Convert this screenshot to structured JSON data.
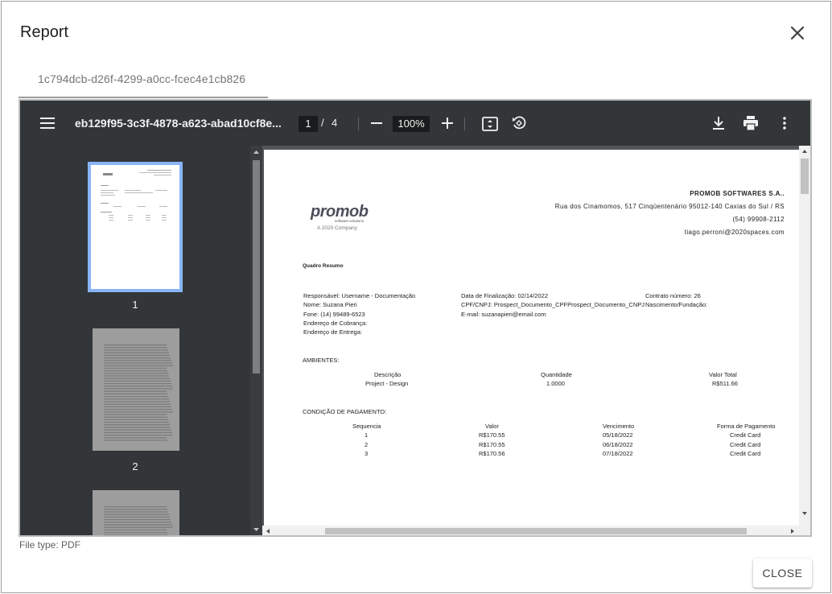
{
  "dialog": {
    "title": "Report",
    "tab_label": "1c794dcb-d26f-4299-a0cc-fcec4e1cb826",
    "file_type": "File type: PDF",
    "close_label": "CLOSE"
  },
  "viewer": {
    "file_title": "eb129f95-3c3f-4878-a623-abad10cf8e...",
    "page_current": "1",
    "page_separator": "/",
    "page_total": "4",
    "zoom": "100%",
    "thumbnails": [
      {
        "number": "1"
      },
      {
        "number": "2"
      }
    ]
  },
  "document": {
    "logo_text": "promob",
    "logo_sub": "software solutions",
    "logo_company": "A 2020 Company",
    "company_name": "PROMOB SOFTWARES S.A..",
    "address": "Rua dos Cinamomos, 517 Cinqüentenário 95012-140 Caxias do Sul / RS",
    "phone": "(54) 99908-2112",
    "email": "tiago.perroni@2020spaces.com",
    "section_title": "Quadro Resumo",
    "info_col1": [
      "Responsável: Username - Documentação",
      "Nome: Suzana Pieri",
      "Fone: (14) 99489-6523",
      "Endereço de Cobrança:",
      "Endereço de Entrega:"
    ],
    "info_col2": [
      "Data de Finalização: 02/14/2022",
      "CPF/CNPJ: Prospect_Documento_CPFProspect_Documento_CNPJ",
      "E-mail: suzanapieri@email.com"
    ],
    "info_col3": [
      "Contrato número: 26",
      "Nascimento/Fundação:"
    ],
    "ambientes_title": "AMBIENTES:",
    "ambientes_headers": [
      "Descrição",
      "Quantidade",
      "Valor Total"
    ],
    "ambientes_rows": [
      [
        "Project - Design",
        "1.0000",
        "R$511.66"
      ]
    ],
    "pagamento_title": "CONDIÇÃO DE PAGAMENTO:",
    "pagamento_headers": [
      "Sequencia",
      "Valor",
      "Vencimento",
      "Forma de Pagamento"
    ],
    "pagamento_rows": [
      [
        "1",
        "R$170.55",
        "05/18/2022",
        "Credit Card"
      ],
      [
        "2",
        "R$170.55",
        "06/18/2022",
        "Credit Card"
      ],
      [
        "3",
        "R$170.56",
        "07/18/2022",
        "Credit Card"
      ]
    ]
  },
  "colors": {
    "toolbar": "#323639",
    "viewer_bg": "#525659",
    "thumb_selected": "#8ab4f8"
  }
}
